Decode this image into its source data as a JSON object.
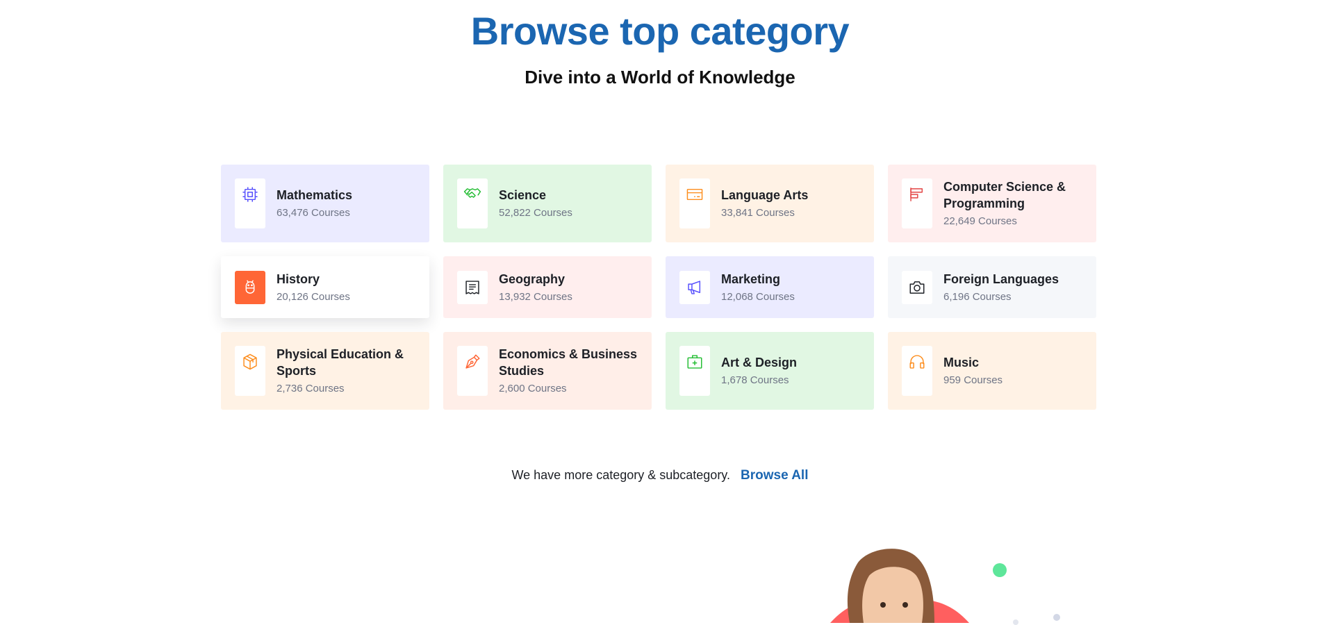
{
  "heading": "Browse top category",
  "subheading": "Dive into a World of Knowledge",
  "categories": [
    {
      "name": "Mathematics",
      "count": "63,476 Courses",
      "icon": "cpu-icon",
      "color": "#564ffd",
      "bg": "#ebebff"
    },
    {
      "name": "Science",
      "count": "52,822 Courses",
      "icon": "handshake-icon",
      "color": "#23bd33",
      "bg": "#e1f7e3"
    },
    {
      "name": "Language Arts",
      "count": "33,841 Courses",
      "icon": "credit-card-icon",
      "color": "#fd8e1f",
      "bg": "#fff2e5"
    },
    {
      "name": "Computer Science & Programming",
      "count": "22,649 Courses",
      "icon": "chart-bar-icon",
      "color": "#e34444",
      "bg": "#ffeeee"
    },
    {
      "name": "History",
      "count": "20,126 Courses",
      "icon": "bug-icon",
      "color": "#ffffff",
      "bg": "#ffffff"
    },
    {
      "name": "Geography",
      "count": "13,932 Courses",
      "icon": "receipt-icon",
      "color": "#1d2026",
      "bg": "#ffeeee"
    },
    {
      "name": "Marketing",
      "count": "12,068 Courses",
      "icon": "megaphone-icon",
      "color": "#564ffd",
      "bg": "#ebebff"
    },
    {
      "name": "Foreign Languages",
      "count": "6,196 Courses",
      "icon": "camera-icon",
      "color": "#1d2026",
      "bg": "#f5f7fa"
    },
    {
      "name": "Physical Education & Sports",
      "count": "2,736 Courses",
      "icon": "package-icon",
      "color": "#fd8e1f",
      "bg": "#fff2e5"
    },
    {
      "name": "Economics & Business Studies",
      "count": "2,600 Courses",
      "icon": "pen-nib-icon",
      "color": "#ff6636",
      "bg": "#ffeee8"
    },
    {
      "name": "Art & Design",
      "count": "1,678 Courses",
      "icon": "first-aid-kit-icon",
      "color": "#23bd33",
      "bg": "#e1f7e3"
    },
    {
      "name": "Music",
      "count": "959 Courses",
      "icon": "headphones-icon",
      "color": "#fd8e1f",
      "bg": "#fff2e5"
    }
  ],
  "more": {
    "text": "We have more category & subcategory.",
    "link": "Browse All"
  }
}
